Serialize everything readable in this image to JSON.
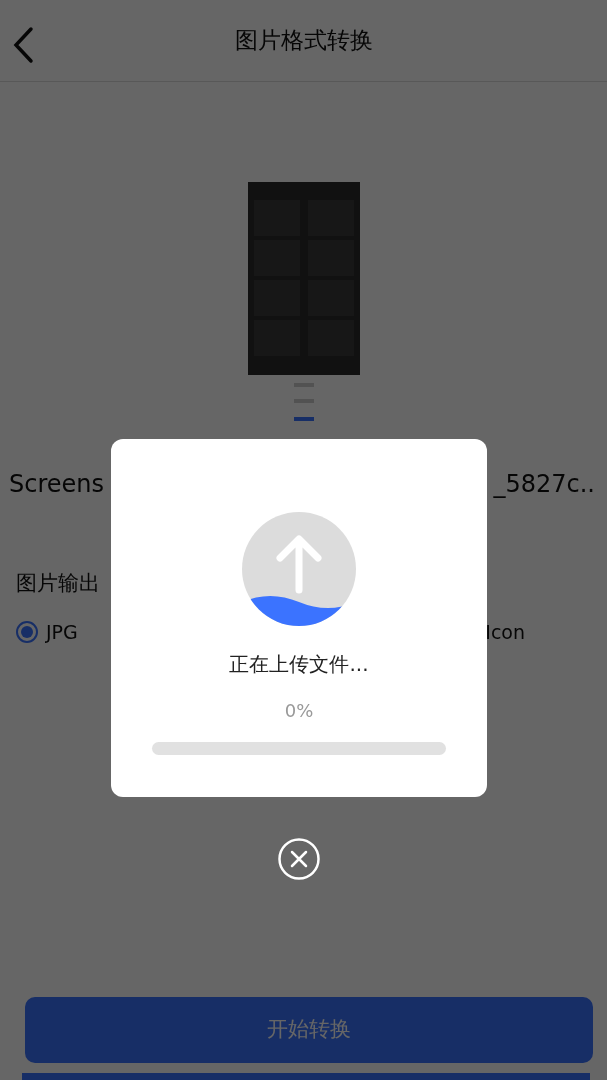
{
  "header": {
    "title": "图片格式转换"
  },
  "file_name": {
    "start": "Screens",
    "end": "_5827c.."
  },
  "output": {
    "label": "图片输出",
    "options": [
      {
        "label": "JPG",
        "selected": true
      },
      {
        "label": "Icon"
      }
    ]
  },
  "start_button": "开始转换",
  "upload_dialog": {
    "message": "正在上传文件...",
    "percent": "0%",
    "level": 0
  }
}
